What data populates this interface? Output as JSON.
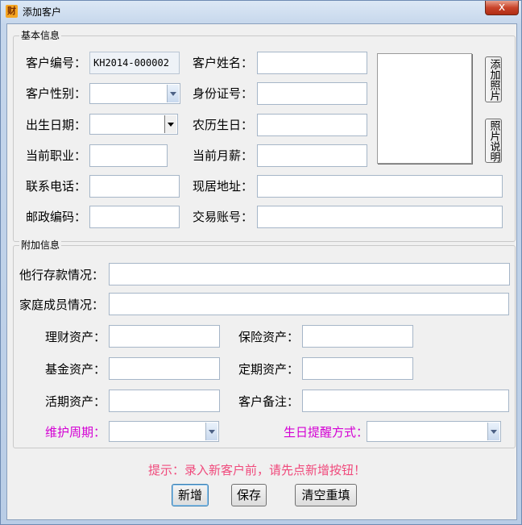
{
  "window": {
    "title": "添加客户",
    "app_icon_glyph": "财",
    "close_glyph": "x"
  },
  "basic": {
    "group_title": "基本信息",
    "customer_no": {
      "label": "客户编号：",
      "value": "KH2014-000002"
    },
    "customer_name": {
      "label": "客户姓名：",
      "value": ""
    },
    "gender": {
      "label": "客户性别：",
      "value": ""
    },
    "id_no": {
      "label": "身份证号：",
      "value": ""
    },
    "birth_date": {
      "label": "出生日期：",
      "value": ""
    },
    "lunar_birthday": {
      "label": "农历生日：",
      "value": ""
    },
    "occupation": {
      "label": "当前职业：",
      "value": ""
    },
    "salary": {
      "label": "当前月薪：",
      "value": ""
    },
    "phone": {
      "label": "联系电话：",
      "value": ""
    },
    "address": {
      "label": "现居地址：",
      "value": ""
    },
    "postcode": {
      "label": "邮政编码：",
      "value": ""
    },
    "account": {
      "label": "交易账号：",
      "value": ""
    },
    "add_photo_label": "添加照片",
    "photo_desc_label": "照片说明"
  },
  "extra": {
    "group_title": "附加信息",
    "other_bank_deposit": {
      "label": "他行存款情况：",
      "value": ""
    },
    "family_members": {
      "label": "家庭成员情况：",
      "value": ""
    },
    "wealth_assets": {
      "label": "理财资产：",
      "value": ""
    },
    "insurance_assets": {
      "label": "保险资产：",
      "value": ""
    },
    "fund_assets": {
      "label": "基金资产：",
      "value": ""
    },
    "fixed_assets": {
      "label": "定期资产：",
      "value": ""
    },
    "demand_assets": {
      "label": "活期资产：",
      "value": ""
    },
    "remarks": {
      "label": "客户备注：",
      "value": ""
    },
    "maintenance_cycle": {
      "label": "维护周期：",
      "value": ""
    },
    "birthday_reminder": {
      "label": "生日提醒方式：",
      "value": ""
    }
  },
  "hint": "提示：录入新客户前，请先点新增按钮！",
  "buttons": {
    "add": "新增",
    "save": "保存",
    "clear": "清空重填"
  },
  "colors": {
    "hint": "#f04a7c",
    "magenta_label": "#d400d4"
  },
  "icons": {
    "app": "app-icon",
    "close": "close-icon",
    "dropdown": "chevron-down-icon"
  }
}
